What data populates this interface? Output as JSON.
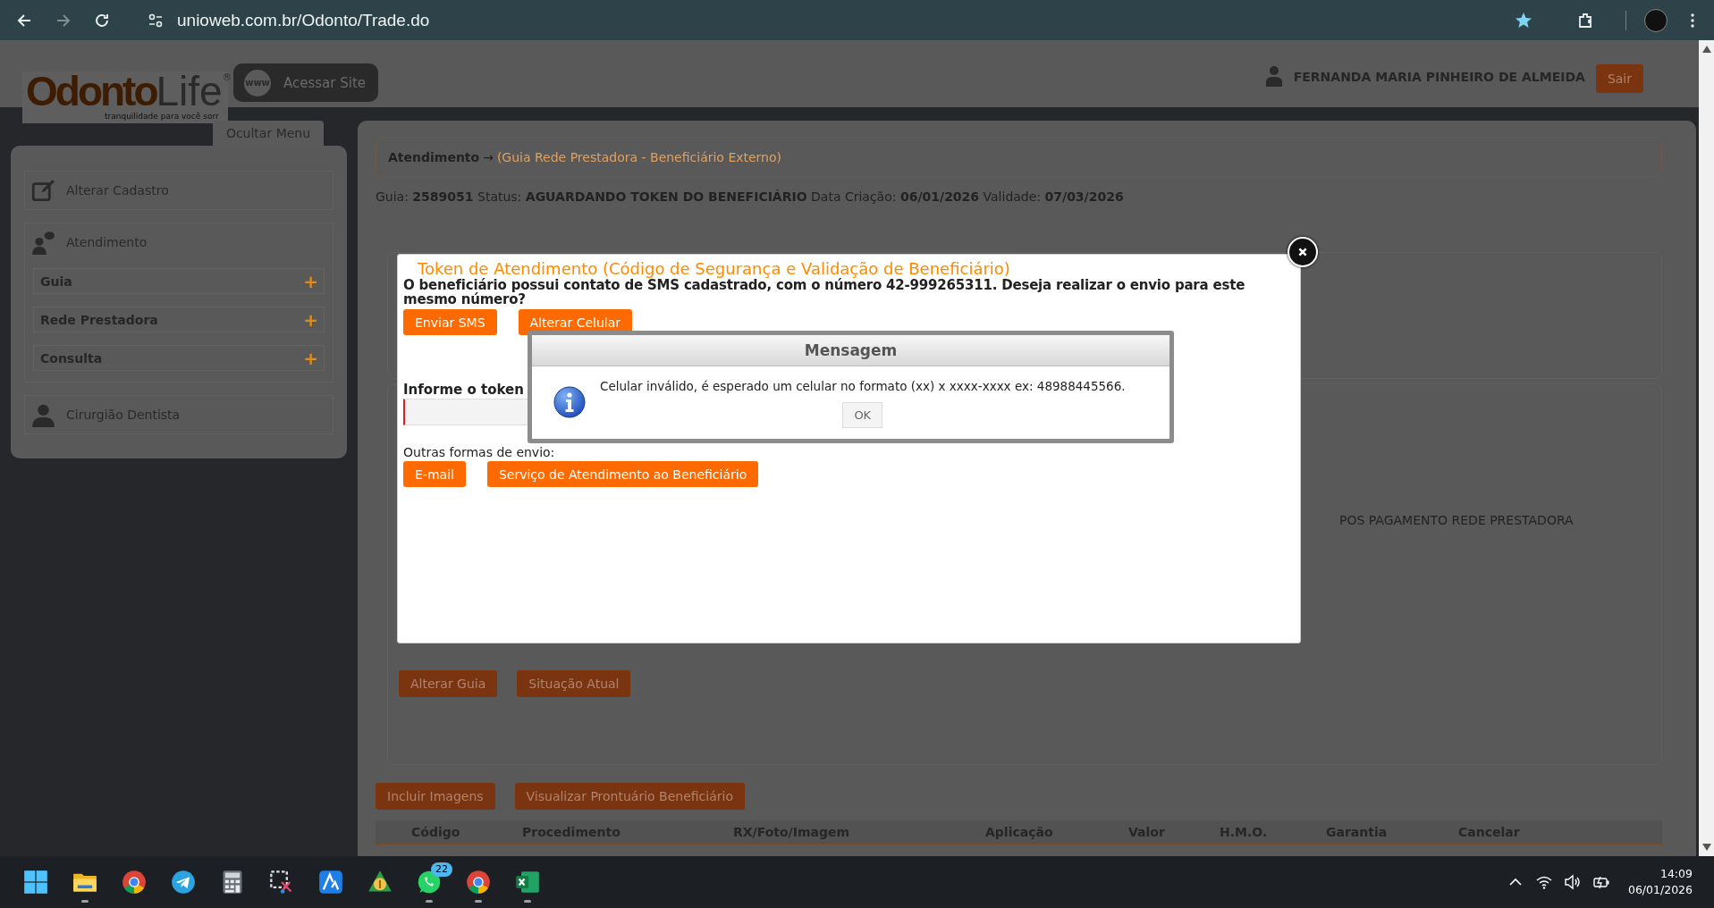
{
  "browser": {
    "url": "unioweb.com.br/Odonto/Trade.do"
  },
  "header": {
    "logo_main": "Odonto",
    "logo_accent": "Life",
    "logo_mark": "®",
    "logo_tagline": "tranquilidade para você sorr",
    "www": "www",
    "site_button": "Acessar Site",
    "user_name": "FERNANDA MARIA PINHEIRO DE ALMEIDA",
    "logout": "Sair"
  },
  "sidebar": {
    "toggle": "Ocultar Menu",
    "sections": [
      {
        "label": "Alterar Cadastro",
        "kind": "edit"
      },
      {
        "label": "Atendimento",
        "kind": "chat",
        "children": [
          {
            "label": "Guia",
            "sign": "+"
          },
          {
            "label": "Rede Prestadora",
            "sign": "+"
          },
          {
            "label": "Consulta",
            "sign": "+"
          }
        ]
      },
      {
        "label": "Cirurgião Dentista",
        "kind": "person"
      }
    ]
  },
  "main": {
    "breadcrumb": {
      "root": "Atendimento",
      "arrow": "→",
      "current": "(Guia Rede Prestadora - Beneficiário Externo)"
    },
    "info": "Guia: **2589051** Status: **AGUARDANDO TOKEN DO BENEFICIÁRIO** Data Criação: **06/01/2026** Validade: **07/03/2026**",
    "partial_text": "POS PAGAMENTO REDE PRESTADORA",
    "actions": [
      "Alterar Guia",
      "Situação Atual"
    ],
    "media_actions": [
      "Incluir Imagens",
      "Visualizar Prontuário Beneficiário"
    ],
    "table": {
      "columns": [
        "Código",
        "Procedimento",
        "RX/Foto/Imagem",
        "Aplicação",
        "Valor",
        "H.M.O.",
        "Garantia",
        "Cancelar"
      ]
    }
  },
  "modal": {
    "title": "Token de Atendimento (Código de Segurança e Validação de Beneficiário)",
    "question": "O beneficiário possui contato de SMS cadastrado, com o número 42-999265311. Deseja realizar o envio para este mesmo número?",
    "buttons": [
      "Enviar SMS",
      "Alterar Celular"
    ],
    "token_label": "Informe o token",
    "other_label": "Outras formas de envio:",
    "other_buttons": [
      "E-mail",
      "Serviço de Atendimento ao Beneficiário"
    ]
  },
  "message": {
    "title": "Mensagem",
    "text": "Celular inválido, é esperado um celular no formato (xx) x xxxx-xxxx ex: 48988445566.",
    "ok": "OK"
  },
  "taskbar": {
    "apps": [
      {
        "kind": "start",
        "running": false
      },
      {
        "kind": "folder",
        "running": true
      },
      {
        "kind": "chrome",
        "running": false
      },
      {
        "kind": "telegram",
        "running": false
      },
      {
        "kind": "calculator",
        "running": false
      },
      {
        "kind": "snip",
        "running": false
      },
      {
        "kind": "bluea",
        "running": false
      },
      {
        "kind": "money",
        "running": false
      },
      {
        "kind": "whatsapp",
        "running": true,
        "badge": "22"
      },
      {
        "kind": "chrome",
        "running": true
      },
      {
        "kind": "excel",
        "running": true
      }
    ],
    "time": "14:09",
    "date": "06/01/2026"
  }
}
